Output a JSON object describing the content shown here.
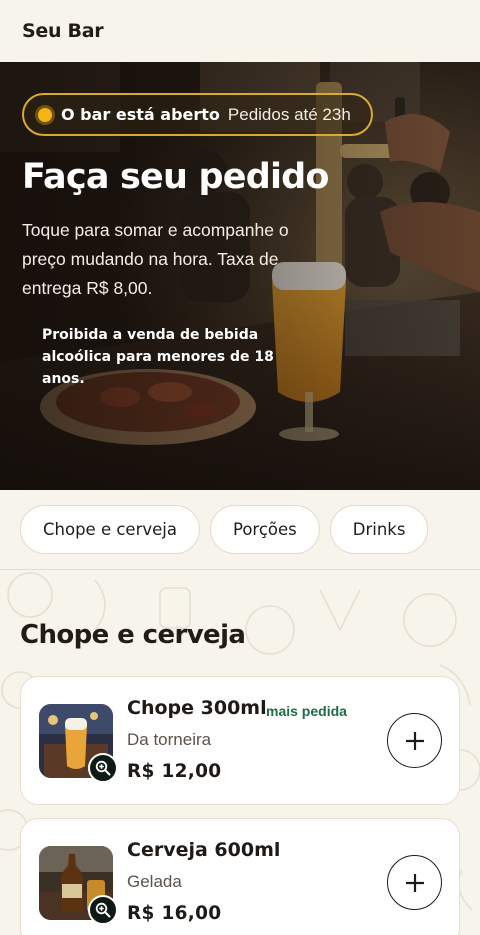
{
  "header": {
    "brand": "Seu Bar"
  },
  "hero": {
    "status_title": "O bar está aberto",
    "status_sub": "Pedidos até 23h",
    "title": "Faça seu pedido",
    "description": "Toque para somar e acompanhe o preço mudando na hora. Taxa de entrega R$ 8,00.",
    "warning": "Proibida a venda de bebida alcoólica para menores de 18 anos."
  },
  "categories": [
    "Chope e cerveja",
    "Porções",
    "Drinks"
  ],
  "section": {
    "title": "Chope e cerveja",
    "items": [
      {
        "name": "Chope 300ml",
        "badge": "mais pedida",
        "description": "Da torneira",
        "price": "R$ 12,00"
      },
      {
        "name": "Cerveja 600ml",
        "badge": "",
        "description": "Gelada",
        "price": "R$ 16,00"
      }
    ]
  },
  "colors": {
    "background": "#f7f4ec",
    "accent_gold": "#d9aa2f",
    "status_dot": "#f3b417",
    "badge_green": "#1e6b47"
  },
  "icons": {
    "zoom": "zoom-in-icon",
    "add": "plus-icon",
    "status": "status-dot-icon"
  }
}
